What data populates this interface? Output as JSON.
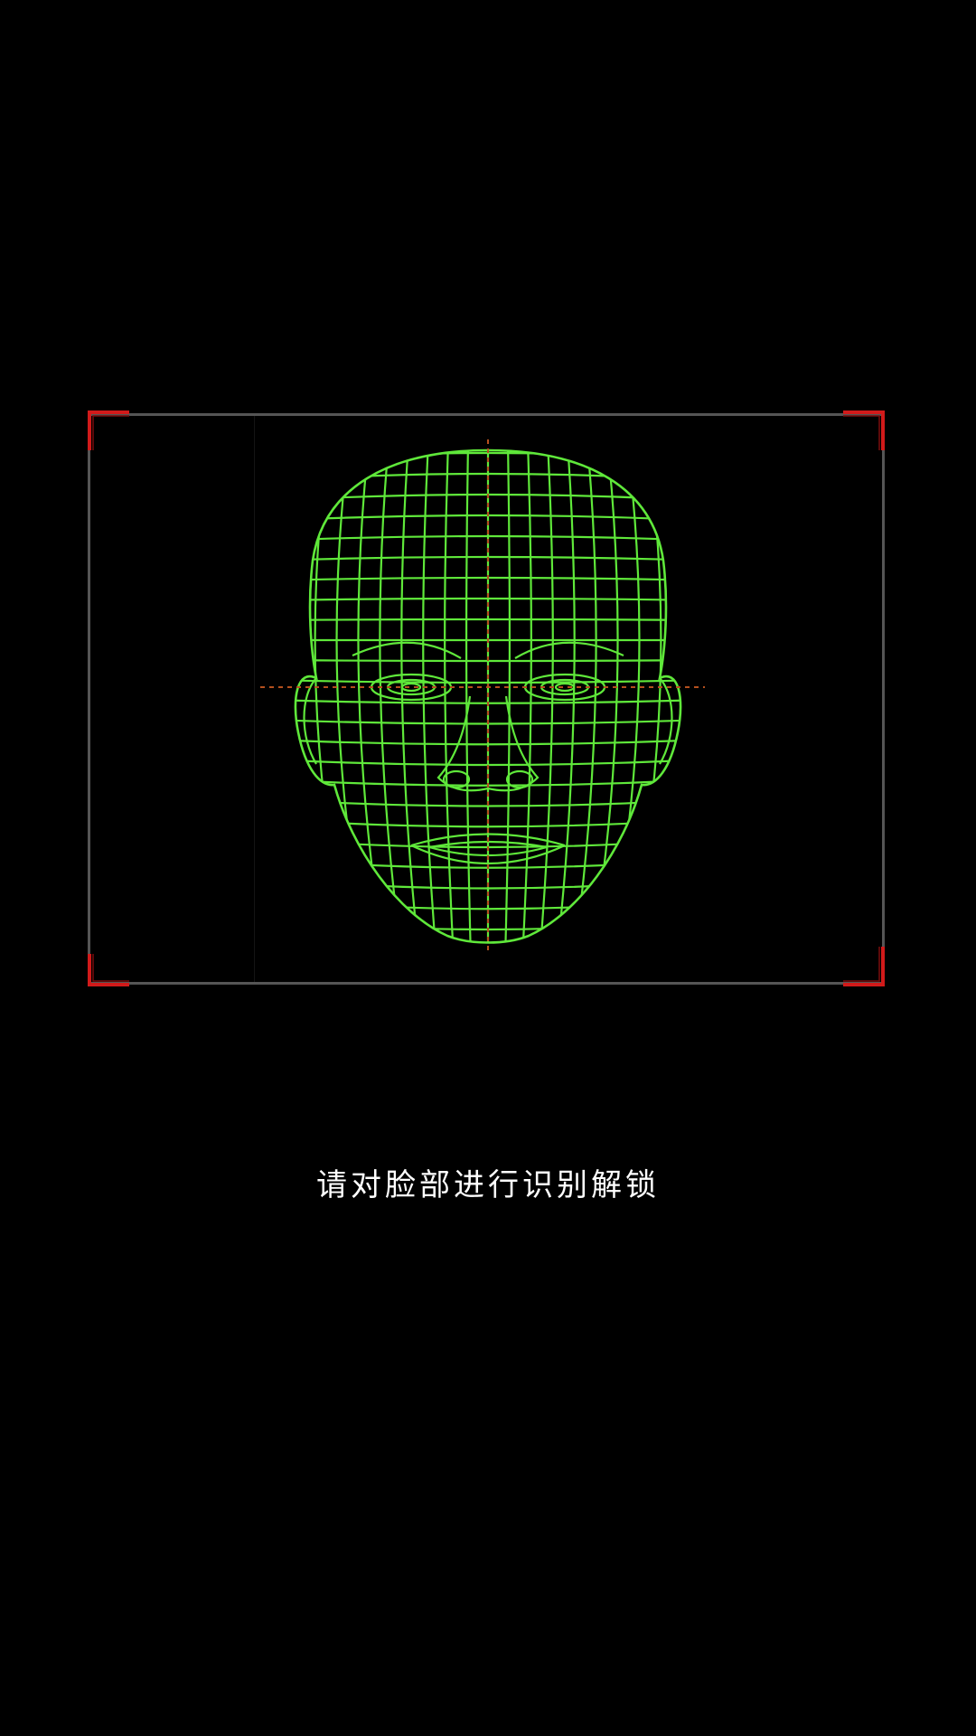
{
  "face_unlock": {
    "prompt_text": "请对脸部进行识别解锁",
    "frame_color": "#555555",
    "corner_color": "#d11a1a",
    "mesh_color": "#5fe83a",
    "crosshair_color": "#b4501e",
    "icons": {
      "face_mesh": "face-wireframe-icon",
      "corners": "scan-corner-icon"
    }
  }
}
